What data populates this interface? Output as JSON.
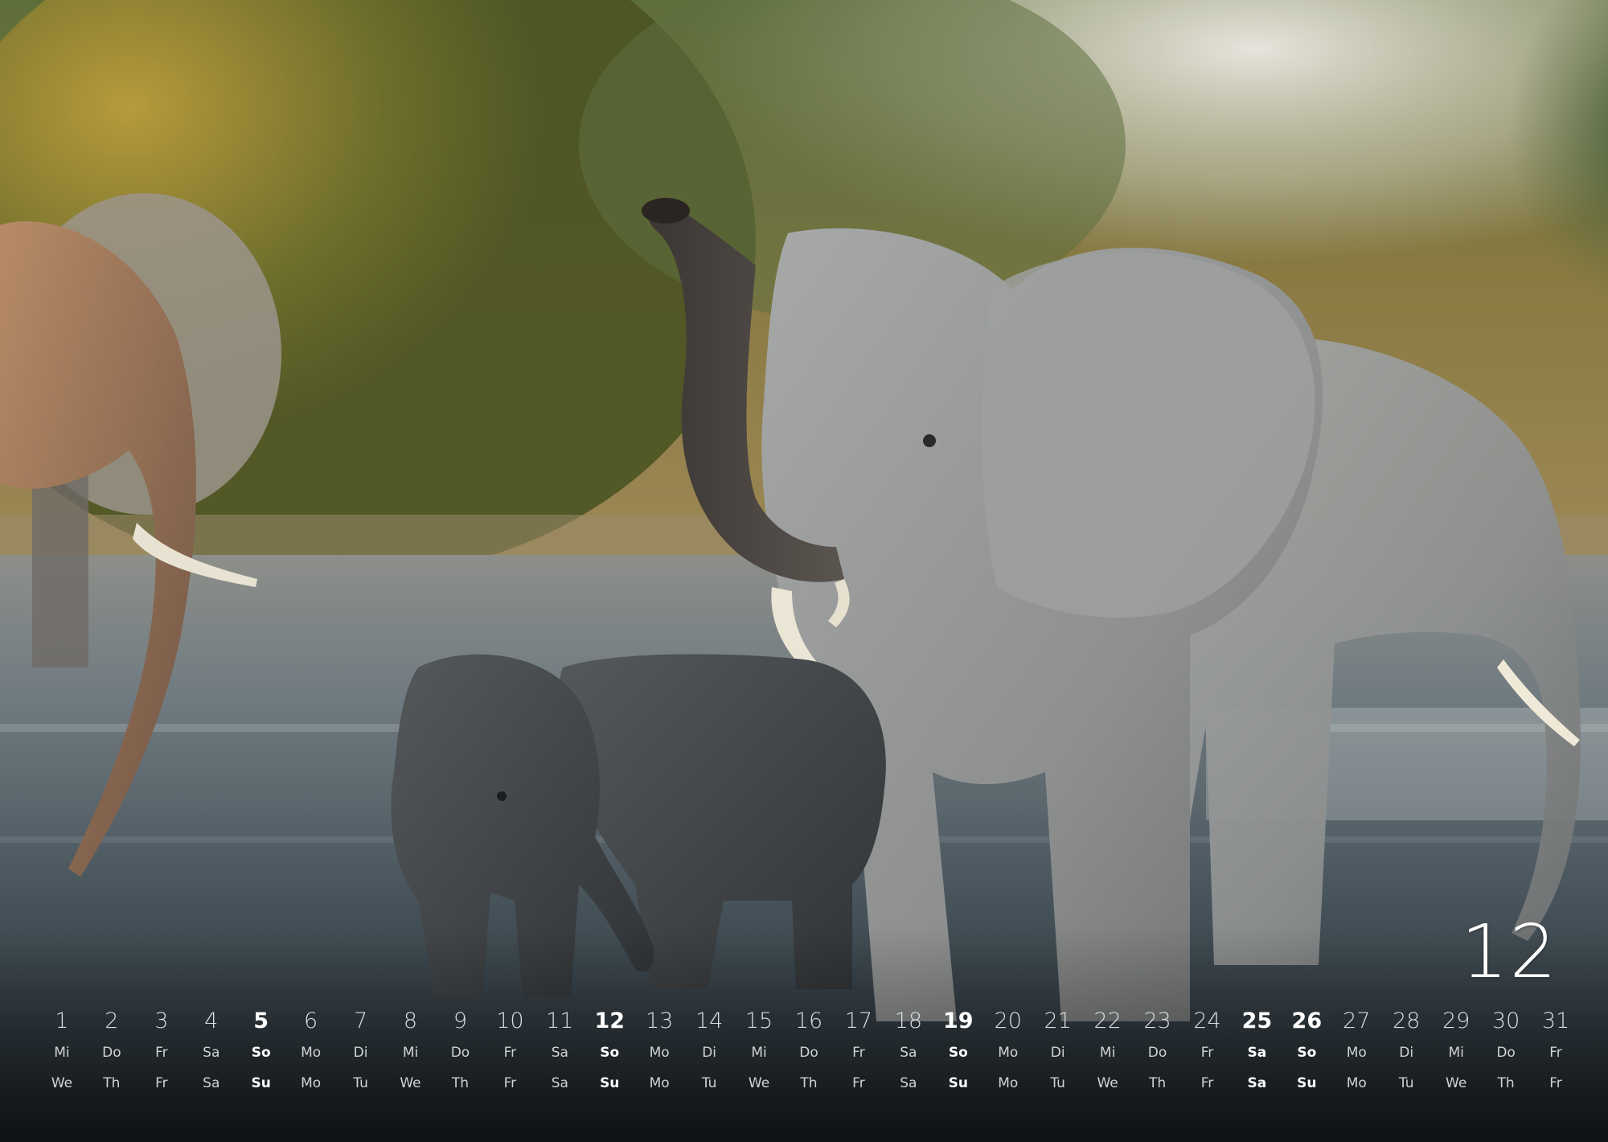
{
  "month": "12",
  "days": [
    {
      "n": "1",
      "de": "Mi",
      "en": "We",
      "hl": false
    },
    {
      "n": "2",
      "de": "Do",
      "en": "Th",
      "hl": false
    },
    {
      "n": "3",
      "de": "Fr",
      "en": "Fr",
      "hl": false
    },
    {
      "n": "4",
      "de": "Sa",
      "en": "Sa",
      "hl": false
    },
    {
      "n": "5",
      "de": "So",
      "en": "Su",
      "hl": true
    },
    {
      "n": "6",
      "de": "Mo",
      "en": "Mo",
      "hl": false
    },
    {
      "n": "7",
      "de": "Di",
      "en": "Tu",
      "hl": false
    },
    {
      "n": "8",
      "de": "Mi",
      "en": "We",
      "hl": false
    },
    {
      "n": "9",
      "de": "Do",
      "en": "Th",
      "hl": false
    },
    {
      "n": "10",
      "de": "Fr",
      "en": "Fr",
      "hl": false
    },
    {
      "n": "11",
      "de": "Sa",
      "en": "Sa",
      "hl": false
    },
    {
      "n": "12",
      "de": "So",
      "en": "Su",
      "hl": true
    },
    {
      "n": "13",
      "de": "Mo",
      "en": "Mo",
      "hl": false
    },
    {
      "n": "14",
      "de": "Di",
      "en": "Tu",
      "hl": false
    },
    {
      "n": "15",
      "de": "Mi",
      "en": "We",
      "hl": false
    },
    {
      "n": "16",
      "de": "Do",
      "en": "Th",
      "hl": false
    },
    {
      "n": "17",
      "de": "Fr",
      "en": "Fr",
      "hl": false
    },
    {
      "n": "18",
      "de": "Sa",
      "en": "Sa",
      "hl": false
    },
    {
      "n": "19",
      "de": "So",
      "en": "Su",
      "hl": true
    },
    {
      "n": "20",
      "de": "Mo",
      "en": "Mo",
      "hl": false
    },
    {
      "n": "21",
      "de": "Di",
      "en": "Tu",
      "hl": false
    },
    {
      "n": "22",
      "de": "Mi",
      "en": "We",
      "hl": false
    },
    {
      "n": "23",
      "de": "Do",
      "en": "Th",
      "hl": false
    },
    {
      "n": "24",
      "de": "Fr",
      "en": "Fr",
      "hl": false
    },
    {
      "n": "25",
      "de": "Sa",
      "en": "Sa",
      "hl": true
    },
    {
      "n": "26",
      "de": "So",
      "en": "Su",
      "hl": true
    },
    {
      "n": "27",
      "de": "Mo",
      "en": "Mo",
      "hl": false
    },
    {
      "n": "28",
      "de": "Di",
      "en": "Tu",
      "hl": false
    },
    {
      "n": "29",
      "de": "Mi",
      "en": "We",
      "hl": false
    },
    {
      "n": "30",
      "de": "Do",
      "en": "Th",
      "hl": false
    },
    {
      "n": "31",
      "de": "Fr",
      "en": "Fr",
      "hl": false
    }
  ]
}
